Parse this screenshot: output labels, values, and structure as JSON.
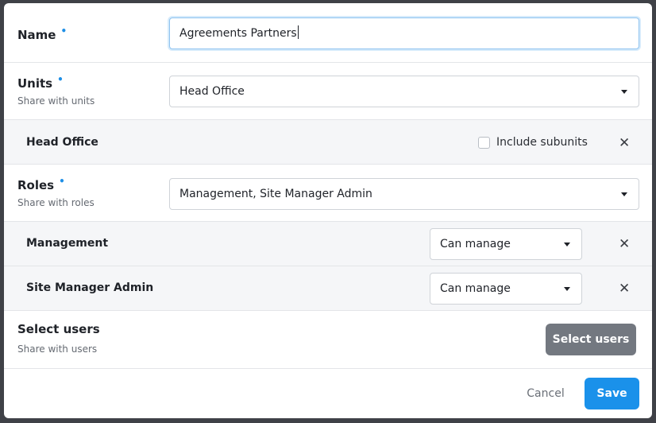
{
  "form": {
    "name": {
      "label": "Name",
      "required_mark": "•",
      "value": "Agreements Partners"
    },
    "units": {
      "label": "Units",
      "required_mark": "•",
      "hint": "Share with units",
      "selected": "Head Office"
    },
    "unit_rows": [
      {
        "name": "Head Office",
        "include_subunits_label": "Include subunits",
        "include_subunits": false
      }
    ],
    "roles": {
      "label": "Roles",
      "required_mark": "•",
      "hint": "Share with roles",
      "selected": "Management, Site Manager Admin"
    },
    "role_rows": [
      {
        "name": "Management",
        "permission": "Can manage"
      },
      {
        "name": "Site Manager Admin",
        "permission": "Can manage"
      }
    ],
    "users": {
      "label": "Select users",
      "hint": "Share with users",
      "button_label": "Select users"
    }
  },
  "footer": {
    "cancel_label": "Cancel",
    "save_label": "Save"
  },
  "icons": {
    "remove": "close-icon",
    "dropdown": "chevron-down-icon"
  },
  "colors": {
    "primary": "#1a91ea",
    "secondary_button": "#737880",
    "required": "#1e8fe6"
  }
}
